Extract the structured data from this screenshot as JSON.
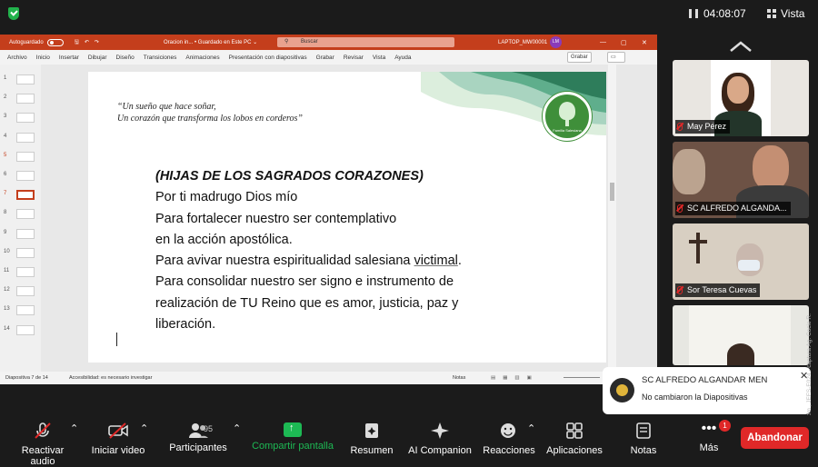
{
  "top": {
    "timer": "04:08:07",
    "view_label": "Vista"
  },
  "ppt": {
    "autosave_label": "Autoguardado",
    "doc_title": "Oracion in... • Guardado en Este PC ⌄",
    "search_placeholder": "Buscar",
    "user": "LAPTOP_MW00001",
    "avatar_initials": "LM",
    "tabs": [
      "Archivo",
      "Inicio",
      "Insertar",
      "Dibujar",
      "Diseño",
      "Transiciones",
      "Animaciones",
      "Presentación con diapositivas",
      "Grabar",
      "Revisar",
      "Vista",
      "Ayuda"
    ],
    "record_btn": "Grabar",
    "thumb_numbers": [
      "1",
      "2",
      "3",
      "4",
      "5",
      "6",
      "7",
      "8",
      "9",
      "10",
      "11",
      "12",
      "13",
      "14"
    ],
    "selected_slide": "7",
    "status_slide": "Diapositiva 7 de 14",
    "status_accessibility": "Accesibilidad: es necesario investigar",
    "status_notes": "Notas"
  },
  "slide": {
    "quote_line1": "“Un sueño que hace soñar,",
    "quote_line2": "Un corazón que transforma los lobos en corderos”",
    "logo_text": "Familia Salesiana",
    "heading": "(HIJAS DE LOS SAGRADOS CORAZONES)",
    "lines": [
      "Por ti madrugo Dios mío",
      "Para fortalecer nuestro ser contemplativo",
      "en la acción apostólica.",
      "Para consolidar nuestro ser signo e instrumento de",
      "realización de TU Reino que es amor, justicia, paz y",
      "liberación."
    ],
    "line4_pre": "Para avivar nuestra espiritualidad salesiana ",
    "line4_underlined": "victimal",
    "line4_post": "."
  },
  "participants": [
    "May Pérez",
    "SC ALFREDO ALGANDA...",
    "Sor Teresa Cuevas"
  ],
  "notification": {
    "sender": "SC ALFREDO ALGANDAR MEN",
    "message": "No cambiaron la Diapositivas",
    "close": "✕"
  },
  "watermark": "Contenido © Zoom , JEFS-E024 - captura Ag. Cocie R.",
  "toolbar": {
    "mute": "Reactivar audio",
    "video": "Iniciar video",
    "participants": "Participantes",
    "participants_count": "95",
    "share": "Compartir pantalla",
    "summary": "Resumen",
    "companion": "AI Companion",
    "reactions": "Reacciones",
    "apps": "Aplicaciones",
    "notes": "Notas",
    "more": "Más",
    "more_badge": "1",
    "leave": "Abandonar"
  },
  "colors": {
    "ppt_red": "#c43e1c",
    "zoom_green": "#1db954",
    "leave_red": "#e02828"
  }
}
